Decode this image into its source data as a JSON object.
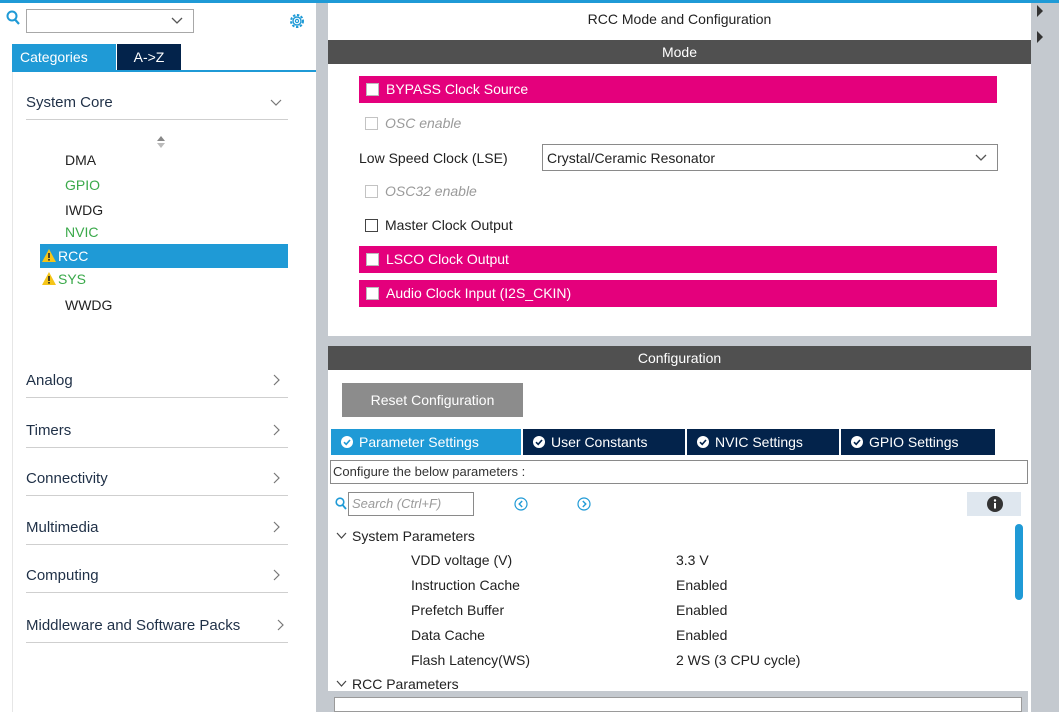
{
  "left_panel": {
    "tabs": {
      "categories": "Categories",
      "a_to_z": "A->Z"
    },
    "system_core": {
      "label": "System Core",
      "items": [
        {
          "label": "DMA",
          "state": "normal"
        },
        {
          "label": "GPIO",
          "state": "configured"
        },
        {
          "label": "IWDG",
          "state": "normal"
        },
        {
          "label": "NVIC",
          "state": "configured"
        },
        {
          "label": "RCC",
          "state": "warning-selected"
        },
        {
          "label": "SYS",
          "state": "warning"
        },
        {
          "label": "WWDG",
          "state": "normal"
        }
      ]
    },
    "categories": [
      {
        "label": "Analog"
      },
      {
        "label": "Timers"
      },
      {
        "label": "Connectivity"
      },
      {
        "label": "Multimedia"
      },
      {
        "label": "Computing"
      },
      {
        "label": "Middleware and Software Packs"
      }
    ]
  },
  "right_panel": {
    "title": "RCC Mode and Configuration",
    "mode_header": "Mode",
    "mode": {
      "bypass": "BYPASS Clock Source",
      "osc_enable": "OSC enable",
      "lse_label": "Low Speed Clock (LSE)",
      "lse_value": "Crystal/Ceramic Resonator",
      "osc32_enable": "OSC32 enable",
      "master_clock_output": "Master Clock Output",
      "lsco": "LSCO Clock Output",
      "audio_clock": "Audio Clock Input (I2S_CKIN)"
    },
    "config_header": "Configuration",
    "config": {
      "reset_button": "Reset Configuration",
      "tabs": [
        "Parameter Settings",
        "User Constants",
        "NVIC Settings",
        "GPIO Settings"
      ],
      "hint": "Configure the below parameters :",
      "search_placeholder": "Search (Ctrl+F)",
      "groups": {
        "system": "System Parameters",
        "rcc": "RCC Parameters"
      },
      "params": [
        {
          "key": "VDD voltage (V)",
          "value": "3.3 V"
        },
        {
          "key": "Instruction Cache",
          "value": "Enabled"
        },
        {
          "key": "Prefetch Buffer",
          "value": "Enabled"
        },
        {
          "key": "Data Cache",
          "value": "Enabled"
        },
        {
          "key": "Flash Latency(WS)",
          "value": "2 WS (3 CPU cycle)"
        }
      ]
    }
  },
  "colors": {
    "accent": "#1f9ad6",
    "dark_navy": "#03234b",
    "pink": "#e4007c",
    "header_gray": "#505050",
    "green": "#3aa94a",
    "warning": "#f5c518"
  }
}
